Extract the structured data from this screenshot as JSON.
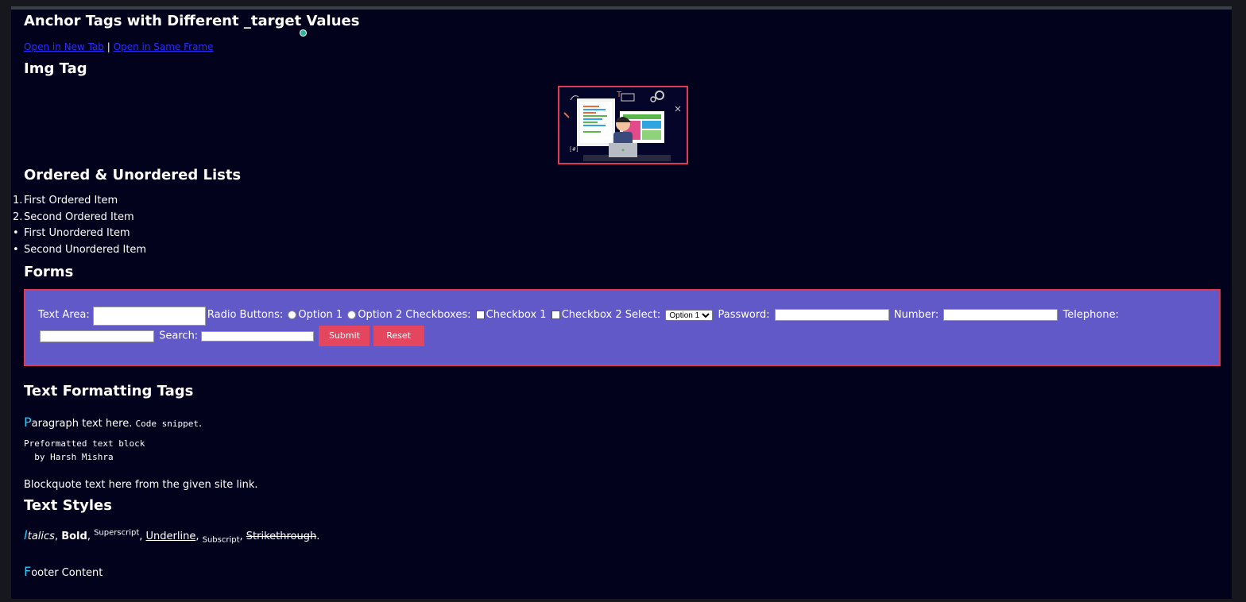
{
  "headings": {
    "anchor": "Anchor Tags with Different _target Values",
    "img": "Img Tag",
    "lists": "Ordered & Unordered Lists",
    "forms": "Forms",
    "text_formatting": "Text Formatting Tags",
    "text_styles": "Text Styles"
  },
  "links": {
    "new_tab": "Open in New Tab",
    "separator": "|",
    "same_frame": "Open in Same Frame"
  },
  "lists": {
    "ordered": [
      {
        "marker": "1.",
        "text": "First Ordered Item"
      },
      {
        "marker": "2.",
        "text": "Second Ordered Item"
      }
    ],
    "unordered": [
      {
        "marker": "•",
        "text": "First Unordered Item"
      },
      {
        "marker": "•",
        "text": "Second Unordered Item"
      }
    ]
  },
  "form": {
    "text_area_label": "Text Area:",
    "radio_label": "Radio Buttons:",
    "radio_1": "Option 1",
    "radio_2": "Option 2",
    "checkbox_label": "Checkboxes:",
    "checkbox_1": "Checkbox 1",
    "checkbox_2": "Checkbox 2",
    "select_label": "Select:",
    "select_value": "Option 1",
    "password_label": "Password:",
    "number_label": "Number:",
    "telephone_label": "Telephone:",
    "search_label": "Search:",
    "submit": "Submit",
    "reset": "Reset"
  },
  "formatting": {
    "para_cap": "P",
    "para_rest": "aragraph text here.",
    "code": "Code snippet",
    "code_end": ".",
    "pre_line1": "Preformatted text block",
    "pre_line2": "  by Harsh Mishra",
    "blockquote": "Blockquote text here from the given site link."
  },
  "styles": {
    "italic_cap": "I",
    "italic_rest": "talics",
    "bold": "Bold",
    "superscript": "Superscript",
    "underline": "Underline",
    "subscript": "Subscript",
    "strike": "Strikethrough"
  },
  "footer": {
    "cap": "F",
    "rest": "ooter Content"
  },
  "colors": {
    "page_bg": "#02021c",
    "form_bg": "#6259c8",
    "accent_border": "#e03a52",
    "button": "#e5465f",
    "link": "#2c2cff",
    "drop_cap": "#2fc4f5"
  }
}
